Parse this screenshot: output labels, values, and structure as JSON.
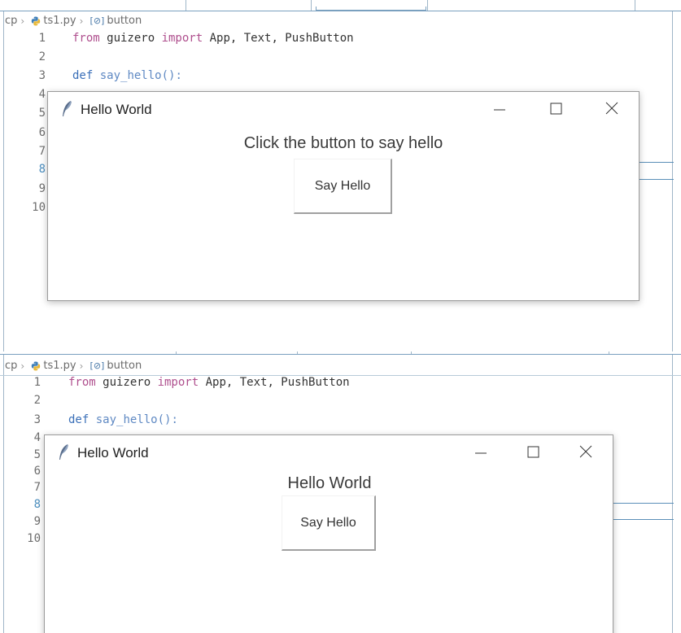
{
  "panels": [
    {
      "breadcrumb": {
        "root": "cp",
        "file": "ts1.py",
        "symbol": "button"
      },
      "lines": [
        "1",
        "2",
        "3",
        "4",
        "5",
        "6",
        "7",
        "8",
        "9",
        "10"
      ],
      "code": {
        "l1_kw1": "from",
        "l1_mod": " guizero ",
        "l1_kw2": "import",
        "l1_rest": " App, Text, PushButton",
        "l3_kw": "def",
        "l3_fn": " say_hello():"
      },
      "window": {
        "title": "Hello World",
        "message": "Click the button to say hello",
        "button": "Say Hello"
      }
    },
    {
      "breadcrumb": {
        "root": "cp",
        "file": "ts1.py",
        "symbol": "button"
      },
      "lines": [
        "1",
        "2",
        "3",
        "4",
        "5",
        "6",
        "7",
        "8",
        "9",
        "10"
      ],
      "code": {
        "l1_kw1": "from",
        "l1_mod": " guizero ",
        "l1_kw2": "import",
        "l1_rest": " App, Text, PushButton",
        "l3_kw": "def",
        "l3_fn": " say_hello():"
      },
      "window": {
        "title": "Hello World",
        "message": "Hello World",
        "button": "Say Hello"
      }
    }
  ],
  "colors": {
    "keyword": "#af4f8e",
    "def_keyword": "#3a6fb8",
    "line_number": "#6e6e6e",
    "breadcrumb": "#6b6b6b"
  },
  "icons": [
    "python-file-icon",
    "symbol-variable-icon",
    "tk-feather-icon",
    "minimize-icon",
    "maximize-icon",
    "close-icon"
  ]
}
